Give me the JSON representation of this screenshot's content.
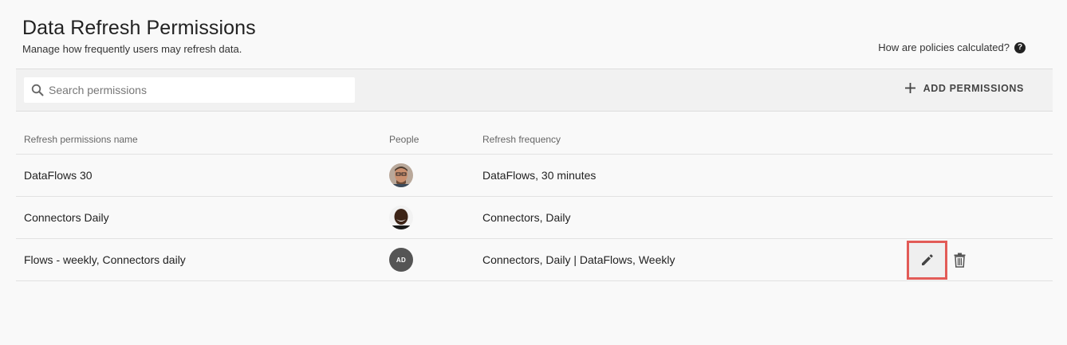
{
  "header": {
    "title": "Data Refresh Permissions",
    "subtitle": "Manage how frequently users may refresh data.",
    "help_link": "How are policies calculated?",
    "help_icon": "question-circle-icon"
  },
  "toolbar": {
    "search_placeholder": "Search permissions",
    "search_value": "",
    "add_label": "ADD PERMISSIONS"
  },
  "table": {
    "columns": [
      "Refresh permissions name",
      "People",
      "Refresh frequency"
    ],
    "rows": [
      {
        "name": "DataFlows 30",
        "avatar": "photo-man-glasses",
        "frequency": "DataFlows, 30 minutes"
      },
      {
        "name": "Connectors Daily",
        "avatar": "photo-man-smiling",
        "frequency": "Connectors, Daily"
      },
      {
        "name": "Flows - weekly, Connectors daily",
        "avatar_initials": "AD",
        "frequency": "Connectors, Daily | DataFlows, Weekly"
      }
    ]
  },
  "colors": {
    "highlight": "#e25b57",
    "avatar_initials_bg": "#555555"
  }
}
